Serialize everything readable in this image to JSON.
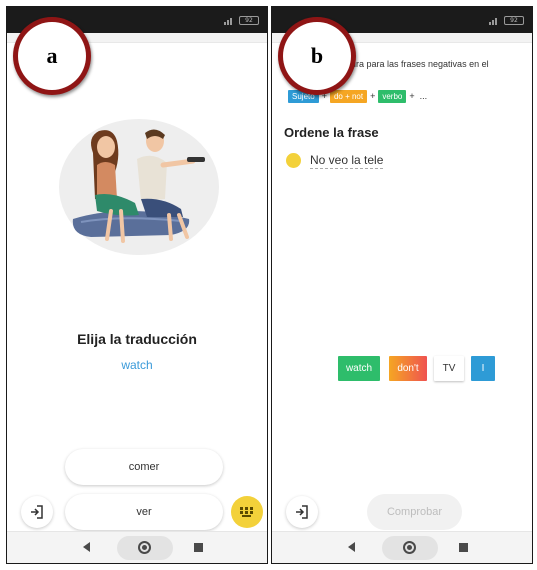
{
  "panels": [
    {
      "label": "a",
      "prompt_title": "Elija la traducción",
      "prompt_word": "watch",
      "answers": [
        "comer",
        "ver"
      ]
    },
    {
      "label": "b",
      "structure_text": "ctura para las frases negativas en el",
      "structure_chips": [
        {
          "label": "Sujeto",
          "color": "#2e9bd6"
        },
        {
          "label": "do + not",
          "color": "#f5a623"
        },
        {
          "label": "verbo",
          "color": "#2ebd6b"
        }
      ],
      "structure_ellipsis": "...",
      "section_title": "Ordene la frase",
      "sentence": "No veo la tele",
      "word_tiles": [
        {
          "label": "watch",
          "color": "#2ebd6b"
        },
        {
          "label": "don't",
          "color": "#f5a623"
        },
        {
          "label": "TV",
          "color": "#ffffff"
        },
        {
          "label": "I",
          "color": "#2e9bd6"
        }
      ],
      "check_label": "Comprobar"
    }
  ],
  "status": {
    "battery": "92"
  },
  "colors": {
    "accent_blue": "#3a9ad9",
    "keyboard_yellow": "#f3d13a",
    "badge_red": "#8f1515"
  },
  "icons": [
    "exit-icon",
    "keyboard-icon",
    "lightbulb-icon",
    "nav-back-icon",
    "nav-home-icon",
    "nav-recent-icon"
  ]
}
